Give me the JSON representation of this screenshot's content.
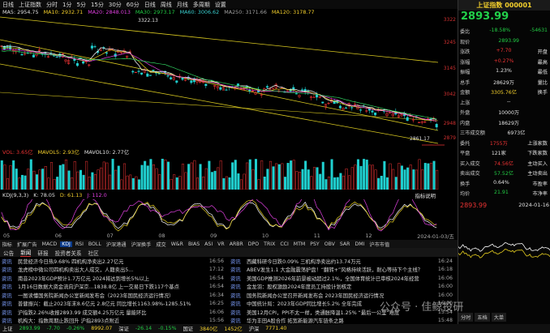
{
  "toolbar": {
    "items": [
      "日线",
      "上证指数",
      "分时",
      "1分",
      "5分",
      "15分",
      "30分",
      "60分",
      "日线",
      "周线",
      "月线",
      "多周期",
      "设置"
    ]
  },
  "ma": {
    "period": "MA5: 2954.75",
    "ma10": "MA10: 2932.71",
    "ma20": "MA20: 2848.013",
    "ma30": "MA30: 2973.17",
    "ma60": "MA60: 3006.62",
    "ma250": "MA250: 3171.66",
    "ma120": "MA120: 3178.77"
  },
  "price_axis": [
    "3322",
    "3245",
    "3145",
    "3042",
    "2948",
    "2879"
  ],
  "annotations": {
    "high": "3322.13",
    "low": "2861.17",
    "last": "2879"
  },
  "vol": {
    "vol": "VOL: 3.65亿",
    "mavol5": "MAVOL5: 2.93亿",
    "mavol10": "MAVOL10: 2.77亿"
  },
  "vol_axis": [
    "242.80万",
    "242.80万"
  ],
  "kdj": {
    "label": "KDJ(9,3,3)",
    "k": "K: 78.05",
    "d": "D: 61.13",
    "j": "J: 112.0",
    "note": "指标说明"
  },
  "kdj_axis": [
    "+52.70",
    "+2.70"
  ],
  "dates": [
    "05",
    "06",
    "07",
    "08",
    "09",
    "10",
    "11",
    "12",
    "2024-01-03/五"
  ],
  "ind_tabs": [
    "指标",
    "扩展广告",
    "MACD",
    "KDJ",
    "RSI",
    "BOLL",
    "沪深港通",
    "沪深换手",
    "成交",
    "W&R",
    "BIAS",
    "ASI",
    "VR",
    "ARBR",
    "DPO",
    "TRIX",
    "CCI",
    "MTM",
    "PSY",
    "OBV",
    "SAR",
    "DMI",
    "沪市市值"
  ],
  "news_tabs": [
    "公告",
    "新闻",
    "研报",
    "投资者关系",
    "社区"
  ],
  "news_left": [
    {
      "src": "资讯",
      "title": "民营经济今日热9.68% 四机构净卖出2.27亿元",
      "time": "16:56"
    },
    {
      "src": "资讯",
      "title": "龙虎榜中微公司四机构卖出大人成交，人籍卖出5...",
      "time": "17:12"
    },
    {
      "src": "资讯",
      "title": "南音2023年GDP预计1.7万亿元 2024将达到增长5%以上",
      "time": "16:54"
    },
    {
      "src": "资讯",
      "title": "1月16日数据大资金流向沪深京...1838.8亿 上一交易日下跌117个基点",
      "time": "16:54"
    },
    {
      "src": "资讯",
      "title": "一图读懂国务院新闻办公室新闻发布会（2023年国民经济运行情况）",
      "time": "16:34"
    },
    {
      "src": "资讯",
      "title": "普健振兴：截止2023年末8.6亿元 2.8亿元 同比增长1163.98%-1285.51%",
      "time": "16:25"
    },
    {
      "src": "资讯",
      "title": "沪指跌2.26%收报2893.99 成交额4.25万亿元 量能环比",
      "time": "16:06"
    },
    {
      "src": "资讯",
      "title": "机构大：指数周期止跌回升 沪指2893点附近",
      "time": "15:56"
    }
  ],
  "news_right": [
    {
      "src": "资讯",
      "title": "西藏科研今日跌0.09% 三机构净卖出约13.74万元",
      "time": "16:24"
    },
    {
      "src": "资讯",
      "title": "ABEV发生1.1 大金融震荡护盘！“翻转+”风格持续活跃，耐心等待下个主线？",
      "time": "16:18"
    },
    {
      "src": "资讯",
      "title": "美国GDP推测2026年前景被动超过2.1%，全国体育统计已审核2024年经营",
      "time": "16:06"
    },
    {
      "src": "资讯",
      "title": "金龙羽：股权激励2024年度员工持股计划核定",
      "time": "16:00"
    },
    {
      "src": "资讯",
      "title": "国务院新闻办公室召开新闻发布会 2023年国民经济运行情况",
      "time": "16:00"
    },
    {
      "src": "资讯",
      "title": "中国统计局：2023年GDP同比增长5.2% 全年完成",
      "time": "16:00"
    },
    {
      "src": "资讯",
      "title": "美国12月CPI，PPI不太一样，类通胀降温1.25% “最后一公里”难度",
      "time": "15:54"
    },
    {
      "src": "资讯",
      "title": "华为丰田A股合作 拓宽新能源汽车链条之路",
      "time": "15:48"
    }
  ],
  "status": [
    "上证",
    "2893.99",
    "-7.70",
    "-0.26%",
    "8992.07",
    "深证",
    "-26.14",
    "-0.15%",
    "国证",
    "3840亿",
    "1452亿",
    "沪深",
    "7771.40"
  ],
  "right": {
    "title": "上证指数 000001",
    "price": "2893.99",
    "rows": [
      {
        "l": "委比",
        "v": "-18.58%",
        "c": "green",
        "r": "-54631",
        "rc": "green"
      },
      {
        "l": "现价",
        "v": "2893.99",
        "c": "green",
        "r": "",
        "rc": ""
      },
      {
        "l": "涨跌",
        "v": "+7.70",
        "c": "red",
        "r": "开盘",
        "rc": "white"
      },
      {
        "l": "涨幅",
        "v": "+0.27%",
        "c": "red",
        "r": "最高",
        "rc": "white"
      },
      {
        "l": "振幅",
        "v": "1.23%",
        "c": "white",
        "r": "最低",
        "rc": "white"
      },
      {
        "l": "总手",
        "v": "28629万",
        "c": "white",
        "r": "量比",
        "rc": "white"
      },
      {
        "l": "金额",
        "v": "3305.76亿",
        "c": "yellow",
        "r": "换手",
        "rc": "white"
      },
      {
        "l": "上涨",
        "v": "--",
        "c": "white",
        "r": "",
        "rc": ""
      },
      {
        "l": "外盘",
        "v": "10000万",
        "c": "white",
        "r": "",
        "rc": ""
      },
      {
        "l": "内盘",
        "v": "18629万",
        "c": "white",
        "r": "",
        "rc": ""
      },
      {
        "l": "三市成交额",
        "v": "6973亿",
        "c": "white",
        "r": "",
        "rc": ""
      },
      {
        "l": "委托",
        "v": "1755万",
        "c": "red",
        "r": "上涨家数",
        "rc": "white"
      },
      {
        "l": "平盘",
        "v": "121家",
        "c": "white",
        "r": "下跌家数",
        "rc": "white"
      },
      {
        "l": "买入成交",
        "v": "74.56亿",
        "c": "red",
        "r": "主动买入",
        "rc": "white"
      },
      {
        "l": "卖出成交",
        "v": "57.52亿",
        "c": "green",
        "r": "主动卖出",
        "rc": "white"
      },
      {
        "l": "换手",
        "v": "0.64%",
        "c": "white",
        "r": "市盈率",
        "rc": "white"
      },
      {
        "l": "均价",
        "v": "21.91",
        "c": "green",
        "r": "市净率",
        "rc": "white"
      }
    ],
    "mini_price": "2893.99",
    "mini_date": "2024-01-16",
    "tabs": [
      "分时",
      "五档",
      "大单"
    ]
  },
  "watermark": "公众号 · 佳鲸投研"
}
